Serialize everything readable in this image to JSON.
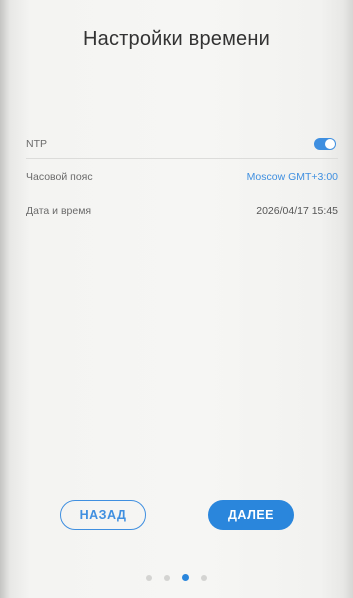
{
  "header": {
    "title": "Настройки времени"
  },
  "settings": {
    "ntp": {
      "label": "NTP",
      "enabled": true
    },
    "timezone": {
      "label": "Часовой пояс",
      "value": "Moscow GMT+3:00"
    },
    "datetime": {
      "label": "Дата и время",
      "value": "2026/04/17 15:45"
    }
  },
  "buttons": {
    "back": "НАЗАД",
    "next": "ДАЛЕЕ"
  },
  "pagination": {
    "total": 4,
    "current": 3
  },
  "colors": {
    "accent": "#2a86dc",
    "link": "#3f8fe0"
  }
}
